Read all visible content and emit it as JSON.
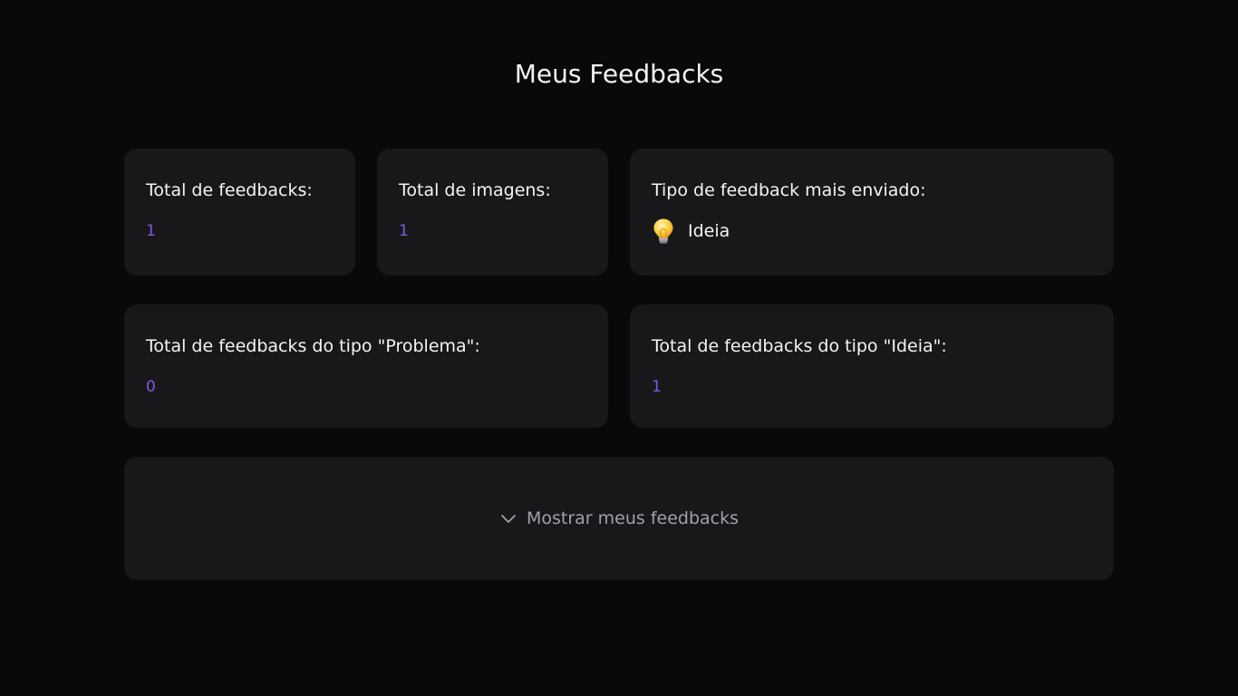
{
  "header": {
    "title": "Meus Feedbacks"
  },
  "stats": {
    "total_feedbacks": {
      "label": "Total de feedbacks:",
      "value": "1"
    },
    "total_images": {
      "label": "Total de imagens:",
      "value": "1"
    },
    "most_sent_type": {
      "label": "Tipo de feedback mais enviado:",
      "value": "Ideia",
      "icon": "lightbulb-icon"
    },
    "problem_count": {
      "label": "Total de feedbacks do tipo \"Problema\":",
      "value": "0"
    },
    "idea_count": {
      "label": "Total de feedbacks do tipo \"Ideia\":",
      "value": "1"
    }
  },
  "toggle": {
    "label": "Mostrar meus feedbacks",
    "icon": "chevron-down-icon"
  },
  "colors": {
    "background": "#09090a",
    "card": "#18181b",
    "accent": "#8257e5",
    "text": "#f4f4f5",
    "muted_text": "#a1a1aa"
  }
}
